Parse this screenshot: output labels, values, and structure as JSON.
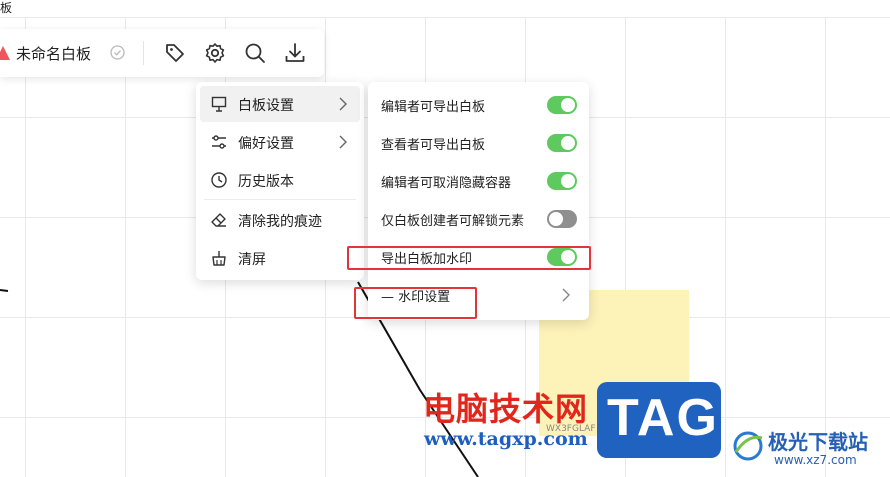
{
  "window": {
    "title_fragment": "板"
  },
  "toolbar": {
    "title": "未命名白板",
    "icons": [
      "tag-icon",
      "gear-icon",
      "search-icon",
      "download-icon"
    ]
  },
  "menu": {
    "items": [
      {
        "label": "白板设置",
        "icon": "whiteboard-icon",
        "has_submenu": true,
        "active": true
      },
      {
        "label": "偏好设置",
        "icon": "sliders-icon",
        "has_submenu": true,
        "active": false
      },
      {
        "label": "历史版本",
        "icon": "clock-icon",
        "has_submenu": false,
        "active": false
      },
      {
        "label": "清除我的痕迹",
        "icon": "eraser-icon",
        "has_submenu": false,
        "active": false
      },
      {
        "label": "清屏",
        "icon": "broom-icon",
        "has_submenu": false,
        "active": false
      }
    ]
  },
  "submenu": {
    "items": [
      {
        "label": "编辑者可导出白板",
        "toggle": "on"
      },
      {
        "label": "查看者可导出白板",
        "toggle": "on"
      },
      {
        "label": "编辑者可取消隐藏容器",
        "toggle": "on"
      },
      {
        "label": "仅白板创建者可解锁元素",
        "toggle": "off"
      },
      {
        "label": "导出白板加水印",
        "toggle": "on"
      },
      {
        "label": "— 水印设置",
        "toggle": null
      }
    ]
  },
  "canvas": {
    "sticky_note_code": "WX3FGLAF"
  },
  "colors": {
    "toggle_on": "#5ec95e",
    "toggle_off": "#8f8f8f",
    "highlight": "#e0353b",
    "sticky": "#fdf2b8"
  },
  "watermark": {
    "site_cn": "电脑技术网",
    "site_url": "www.tagxp.com",
    "tag": "TAG",
    "jiguang_cn": "极光下载站",
    "jiguang_url": "www.xz7.com"
  }
}
